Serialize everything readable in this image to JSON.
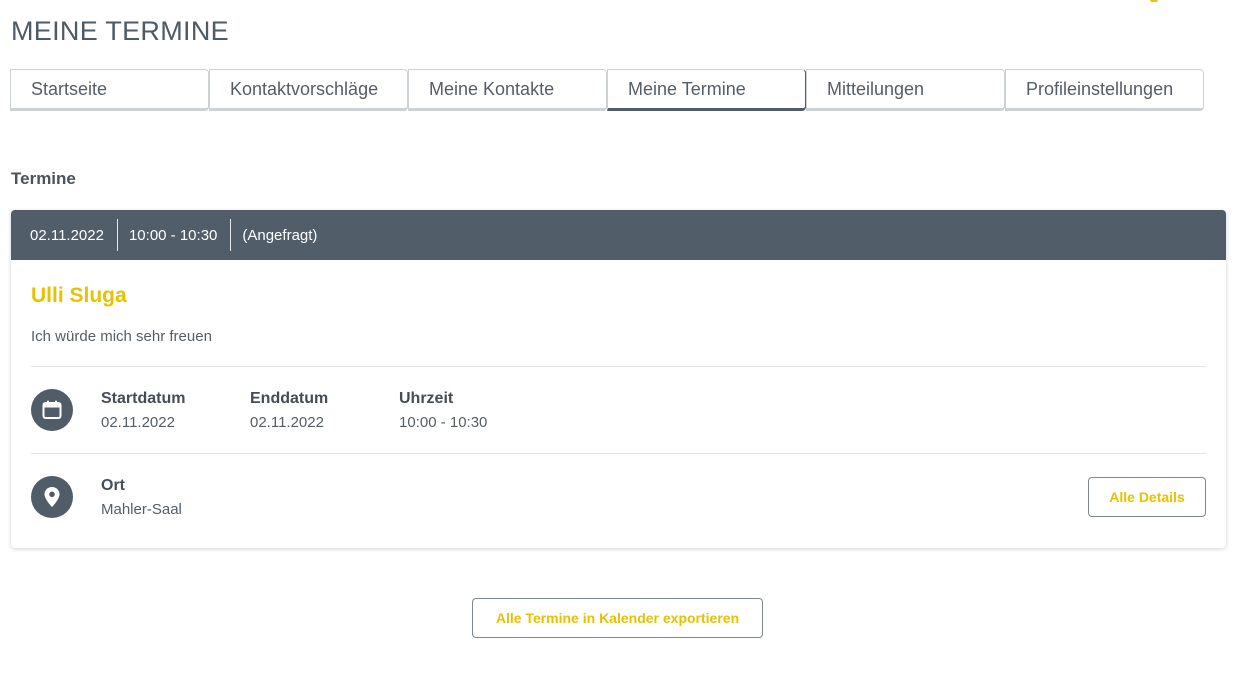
{
  "page": {
    "title": "MEINE TERMINE"
  },
  "tabs": [
    {
      "label": "Startseite",
      "active": false
    },
    {
      "label": "Kontaktvorschläge",
      "active": false
    },
    {
      "label": "Meine Kontakte",
      "active": false
    },
    {
      "label": "Meine Termine",
      "active": true
    },
    {
      "label": "Mitteilungen",
      "active": false
    },
    {
      "label": "Profileinstellungen",
      "active": false
    }
  ],
  "section": {
    "heading": "Termine"
  },
  "appointment": {
    "date": "02.11.2022",
    "time": "10:00 - 10:30",
    "status": "(Angefragt)",
    "person_name": "Ulli Sluga",
    "message": "Ich würde mich sehr freuen",
    "fields": {
      "start_label": "Startdatum",
      "start_value": "02.11.2022",
      "end_label": "Enddatum",
      "end_value": "02.11.2022",
      "time_label": "Uhrzeit",
      "time_value": "10:00 - 10:30"
    },
    "location": {
      "label": "Ort",
      "value": "Mahler-Saal"
    },
    "details_button": "Alle Details",
    "icons": {
      "calendar": "calendar-icon",
      "location": "location-pin-icon"
    }
  },
  "export_button": "Alle Termine in Kalender exportieren",
  "colors": {
    "accent_yellow": "#e9c100",
    "header_slate": "#515d69",
    "icon_circle": "#505c68"
  }
}
